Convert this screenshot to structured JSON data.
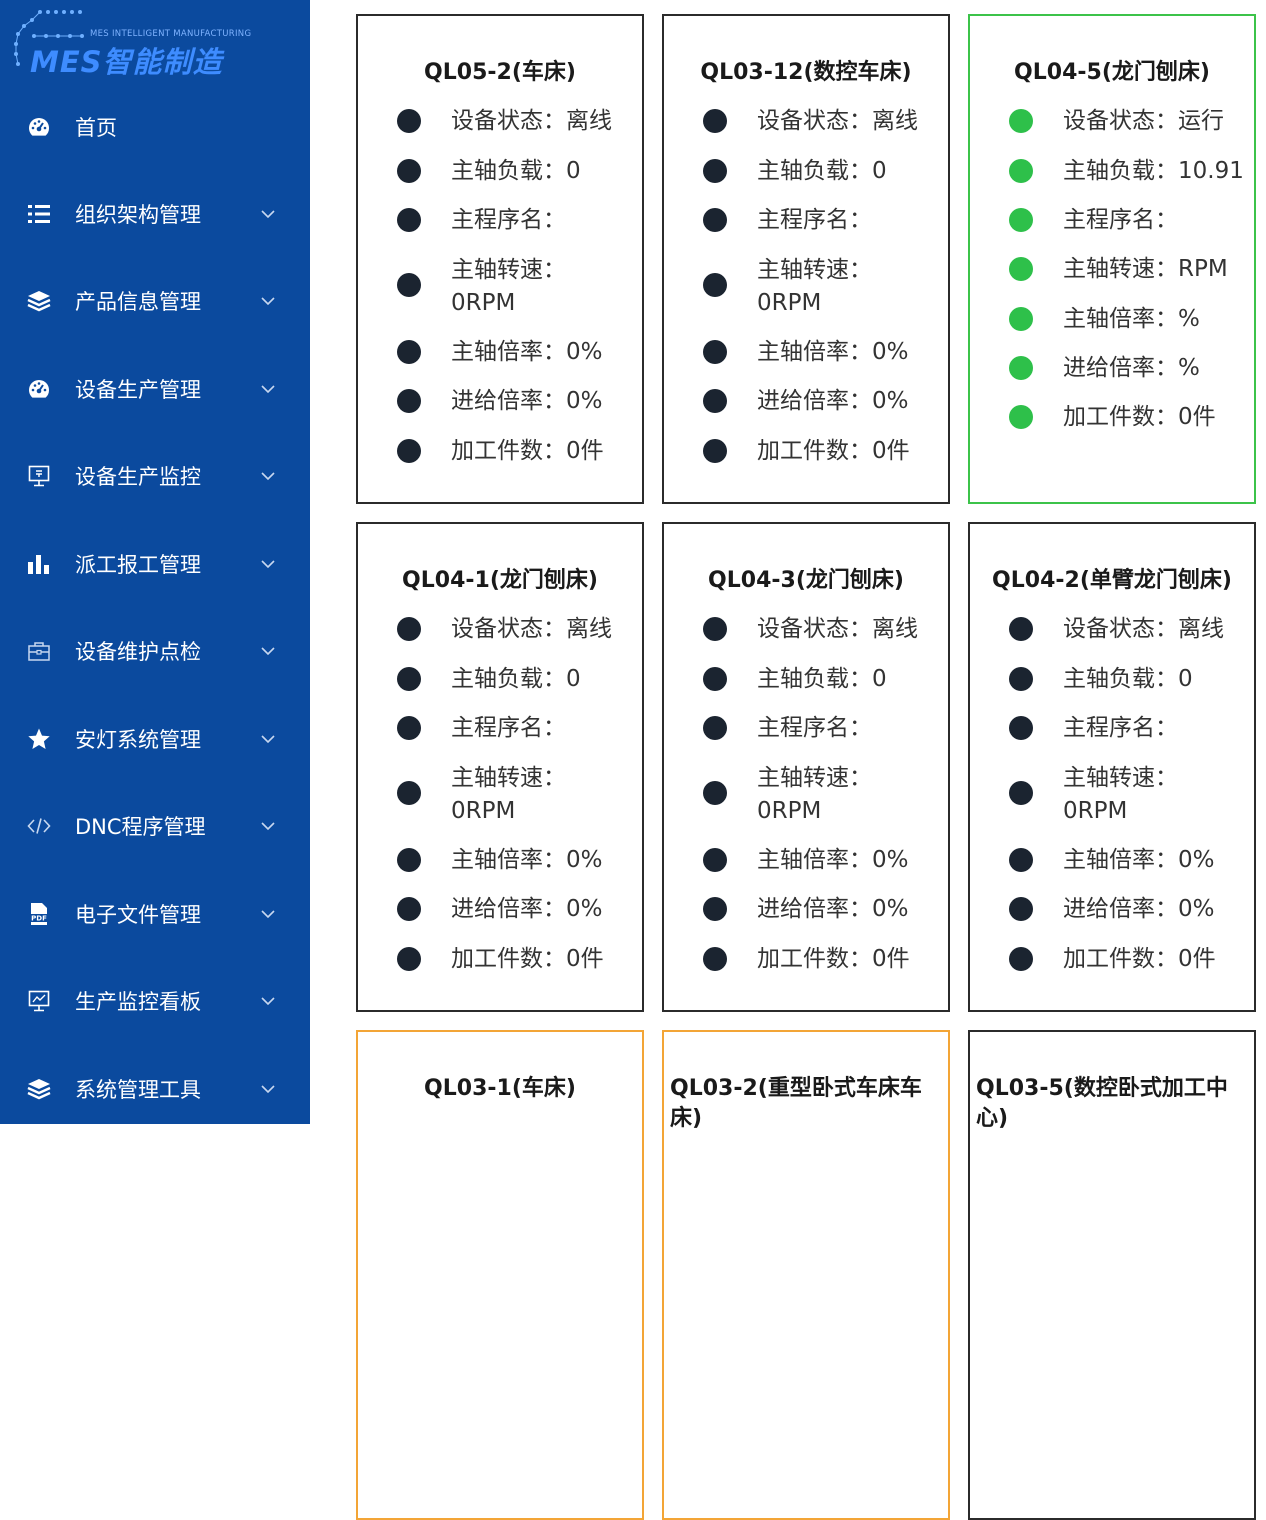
{
  "logo": {
    "subtitle": "MES INTELLIGENT MANUFACTURING",
    "title": "MES智能制造"
  },
  "sidebar": {
    "items": [
      {
        "label": "首页",
        "icon": "dashboard-icon"
      },
      {
        "label": "组织架构管理",
        "icon": "list-icon"
      },
      {
        "label": "产品信息管理",
        "icon": "layers-icon"
      },
      {
        "label": "设备生产管理",
        "icon": "dashboard-icon"
      },
      {
        "label": "设备生产监控",
        "icon": "monitor-icon"
      },
      {
        "label": "派工报工管理",
        "icon": "bar-chart-icon"
      },
      {
        "label": "设备维护点检",
        "icon": "toolbox-icon"
      },
      {
        "label": "安灯系统管理",
        "icon": "star-icon"
      },
      {
        "label": "DNC程序管理",
        "icon": "code-icon"
      },
      {
        "label": "电子文件管理",
        "icon": "pdf-icon"
      },
      {
        "label": "生产监控看板",
        "icon": "chart-monitor-icon"
      },
      {
        "label": "系统管理工具",
        "icon": "layers-icon"
      }
    ]
  },
  "colors": {
    "sidebar": "#0b4a9e",
    "running": "#2ec04a",
    "offline": "#1b2430",
    "warning": "#f3a536"
  },
  "machines": [
    {
      "title": "QL05-2(车床)",
      "status": "offline",
      "rows": [
        "设备状态：离线",
        "主轴负载：0",
        "主程序名：",
        "主轴转速：0RPM",
        "主轴倍率：0%",
        "进给倍率：0%",
        "加工件数：0件"
      ]
    },
    {
      "title": "QL03-12(数控车床)",
      "status": "offline",
      "rows": [
        "设备状态：离线",
        "主轴负载：0",
        "主程序名：",
        "主轴转速：0RPM",
        "主轴倍率：0%",
        "进给倍率：0%",
        "加工件数：0件"
      ]
    },
    {
      "title": "QL04-5(龙门刨床)",
      "status": "running",
      "rows": [
        "设备状态：运行",
        "主轴负载：10.91",
        "主程序名：",
        "主轴转速：RPM",
        "主轴倍率：%",
        "进给倍率：%",
        "加工件数：0件"
      ]
    },
    {
      "title": "QL04-1(龙门刨床)",
      "status": "offline",
      "rows": [
        "设备状态：离线",
        "主轴负载：0",
        "主程序名：",
        "主轴转速：0RPM",
        "主轴倍率：0%",
        "进给倍率：0%",
        "加工件数：0件"
      ]
    },
    {
      "title": "QL04-3(龙门刨床)",
      "status": "offline",
      "rows": [
        "设备状态：离线",
        "主轴负载：0",
        "主程序名：",
        "主轴转速：0RPM",
        "主轴倍率：0%",
        "进给倍率：0%",
        "加工件数：0件"
      ]
    },
    {
      "title": "QL04-2(单臂龙门刨床)",
      "status": "offline",
      "rows": [
        "设备状态：离线",
        "主轴负载：0",
        "主程序名：",
        "主轴转速：0RPM",
        "主轴倍率：0%",
        "进给倍率：0%",
        "加工件数：0件"
      ]
    },
    {
      "title": "QL03-1(车床)",
      "status": "warning"
    },
    {
      "title": "QL03-2(重型卧式车床车床)",
      "status": "warning"
    },
    {
      "title": "QL03-5(数控卧式加工中心)",
      "status": "offline"
    }
  ]
}
